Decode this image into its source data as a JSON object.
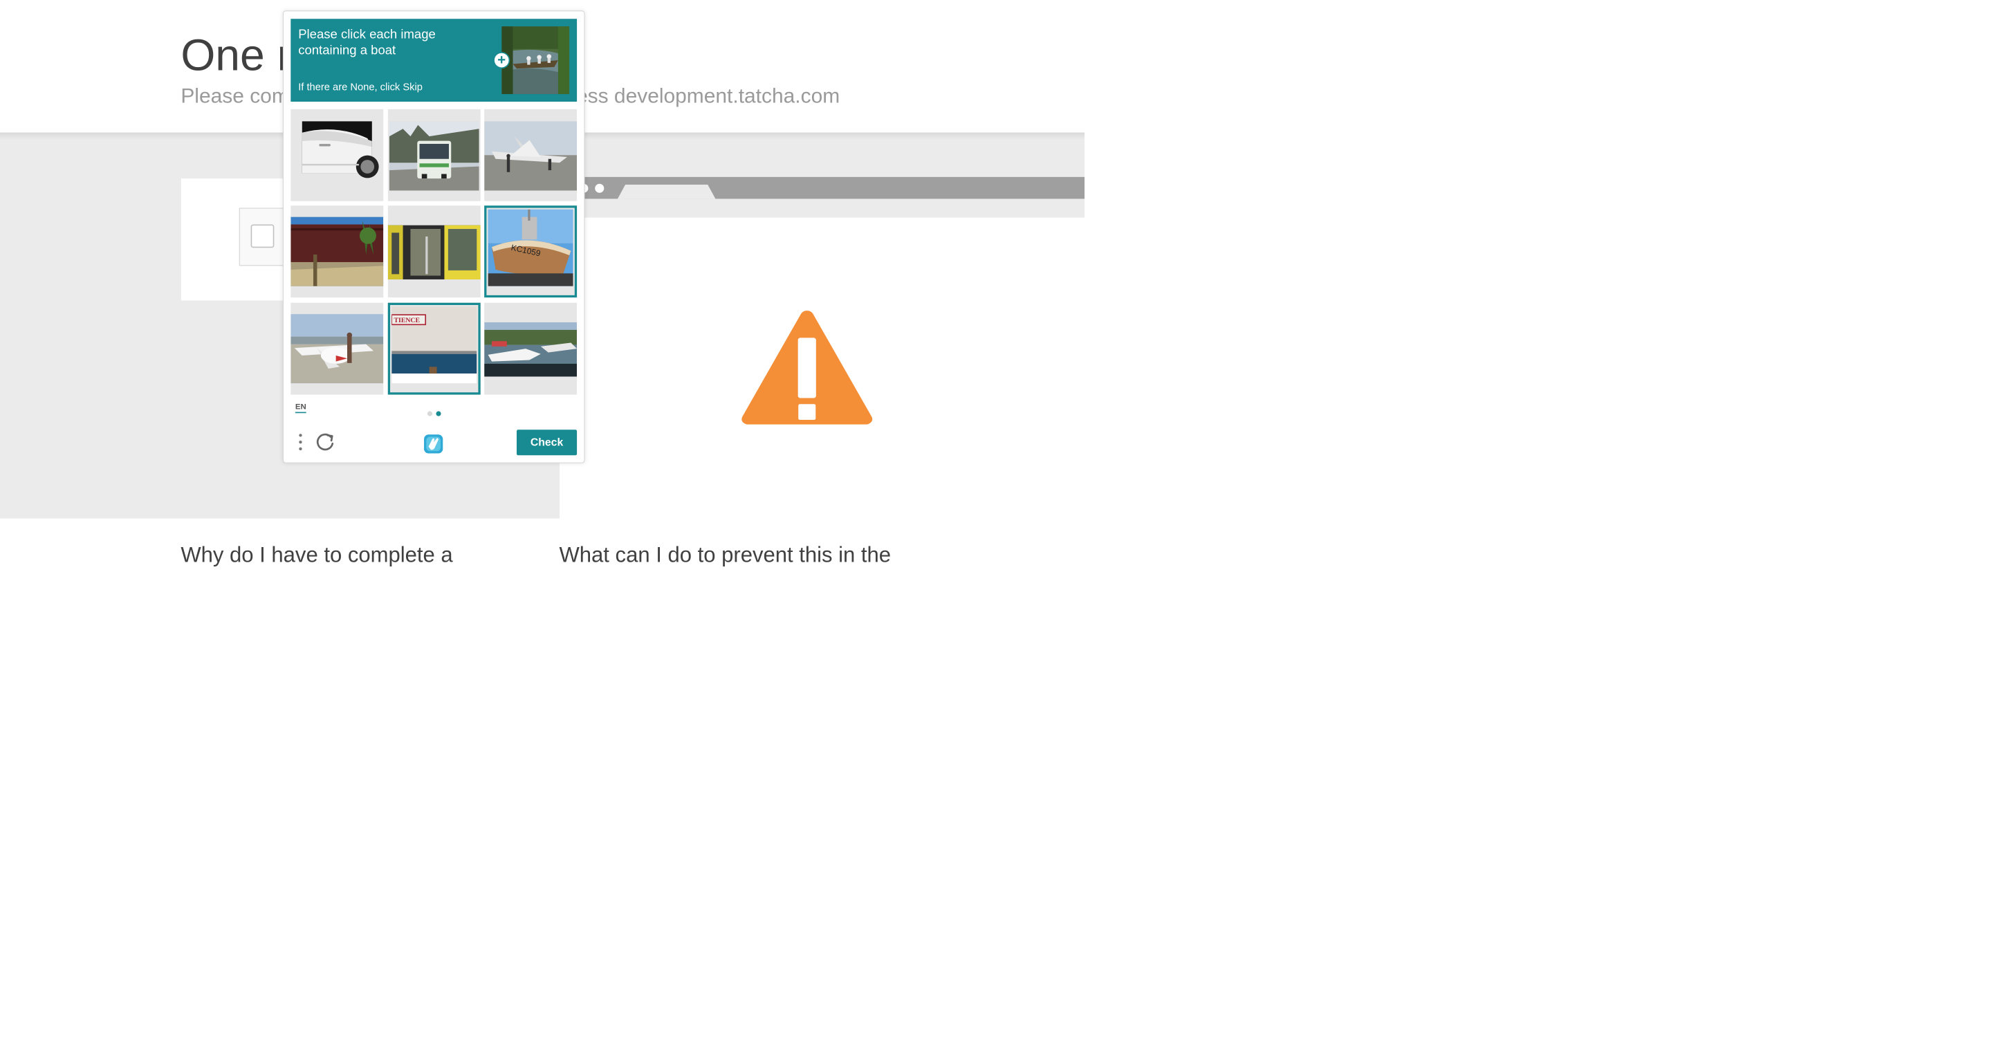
{
  "background_page": {
    "title": "One m",
    "subtitle_left": "Please com",
    "subtitle_right": "ess development.tatcha.com",
    "question_left": "Why do I have to complete a",
    "question_right": "What can I do to prevent this in the"
  },
  "challenge": {
    "prompt_text": "Please click each image containing a boat",
    "prompt_subtext": "If there are None, click Skip",
    "expand_label": "+",
    "tiles": [
      {
        "subject": "car",
        "selected": false
      },
      {
        "subject": "bus",
        "selected": false
      },
      {
        "subject": "airplane",
        "selected": false
      },
      {
        "subject": "train",
        "selected": false
      },
      {
        "subject": "bus",
        "selected": false
      },
      {
        "subject": "boat",
        "selected": true
      },
      {
        "subject": "airplane",
        "selected": false
      },
      {
        "subject": "boat",
        "selected": true
      },
      {
        "subject": "boat",
        "selected": false
      }
    ],
    "language": "EN",
    "pagination": {
      "current": 2,
      "total": 2
    },
    "check_label": "Check",
    "boat_label_tile6": "KC1059",
    "boat_label_tile8": "TIENCE"
  },
  "colors": {
    "accent": "#178a92",
    "warning": "#f48f38",
    "background_gray": "#ebebeb"
  },
  "icons": [
    "menu-dots-icon",
    "refresh-icon",
    "hcaptcha-logo-icon",
    "warning-icon",
    "plus-icon"
  ]
}
